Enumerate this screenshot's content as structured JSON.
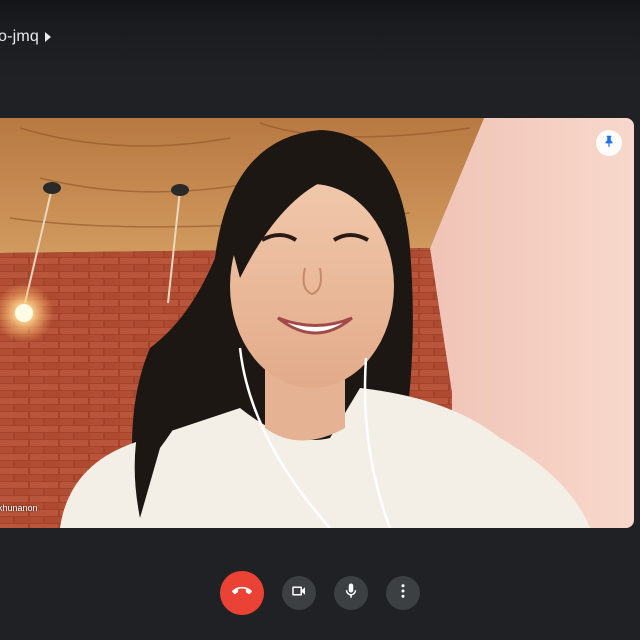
{
  "meeting": {
    "code": "o-jmq",
    "expand_icon": "caret-right-icon"
  },
  "participant": {
    "name": "khunanon",
    "pin_icon": "pin-icon"
  },
  "controls": {
    "hangup_icon": "phone-hangup-icon",
    "camera_icon": "videocam-icon",
    "mic_icon": "mic-icon",
    "more_icon": "more-vert-icon"
  },
  "colors": {
    "background": "#202124",
    "hangup": "#ea4335",
    "control": "#3c4043",
    "pin": "#1a73e8"
  }
}
